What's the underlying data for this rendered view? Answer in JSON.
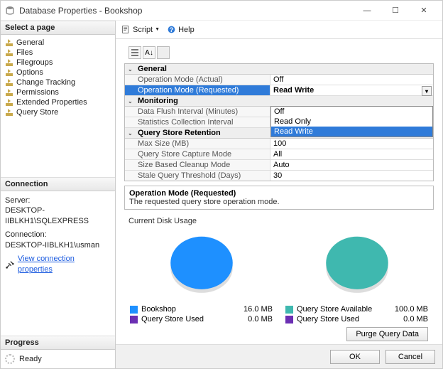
{
  "window": {
    "title": "Database Properties - Bookshop"
  },
  "sidebar": {
    "select_title": "Select a page",
    "pages": [
      "General",
      "Files",
      "Filegroups",
      "Options",
      "Change Tracking",
      "Permissions",
      "Extended Properties",
      "Query Store"
    ],
    "connection_title": "Connection",
    "server_label": "Server:",
    "server_value": "DESKTOP-IIBLKH1\\SQLEXPRESS",
    "connection_label": "Connection:",
    "connection_value": "DESKTOP-IIBLKH1\\usman",
    "view_conn_props": "View connection properties",
    "progress_title": "Progress",
    "progress_status": "Ready"
  },
  "toolbar": {
    "script": "Script",
    "help": "Help"
  },
  "propgrid": {
    "cats": [
      {
        "name": "General",
        "rows": [
          {
            "label": "Operation Mode (Actual)",
            "value": "Off"
          },
          {
            "label": "Operation Mode (Requested)",
            "value": "Read Write",
            "selected": true,
            "dropdown": true
          }
        ]
      },
      {
        "name": "Monitoring",
        "rows": [
          {
            "label": "Data Flush Interval (Minutes)",
            "value": ""
          },
          {
            "label": "Statistics Collection Interval",
            "value": ""
          }
        ],
        "dropdown_items": [
          "Off",
          "Read Only",
          "Read Write"
        ],
        "dropdown_selected": "Read Write"
      },
      {
        "name": "Query Store Retention",
        "rows": [
          {
            "label": "Max Size (MB)",
            "value": "100"
          },
          {
            "label": "Query Store Capture Mode",
            "value": "All"
          },
          {
            "label": "Size Based Cleanup Mode",
            "value": "Auto"
          },
          {
            "label": "Stale Query Threshold (Days)",
            "value": "30"
          }
        ]
      }
    ],
    "desc_title": "Operation Mode (Requested)",
    "desc_text": "The requested query store operation mode."
  },
  "usage": {
    "title": "Current Disk Usage",
    "purge_label": "Purge Query Data"
  },
  "chart_data": [
    {
      "type": "pie",
      "series": [
        {
          "name": "Bookshop",
          "value": 16.0,
          "unit": "MB",
          "color": "#1e90ff"
        },
        {
          "name": "Query Store Used",
          "value": 0.0,
          "unit": "MB",
          "color": "#6b2fb3"
        }
      ]
    },
    {
      "type": "pie",
      "series": [
        {
          "name": "Query Store Available",
          "value": 100.0,
          "unit": "MB",
          "color": "#3fb8af"
        },
        {
          "name": "Query Store Used",
          "value": 0.0,
          "unit": "MB",
          "color": "#6b2fb3"
        }
      ]
    }
  ],
  "footer": {
    "ok": "OK",
    "cancel": "Cancel"
  }
}
